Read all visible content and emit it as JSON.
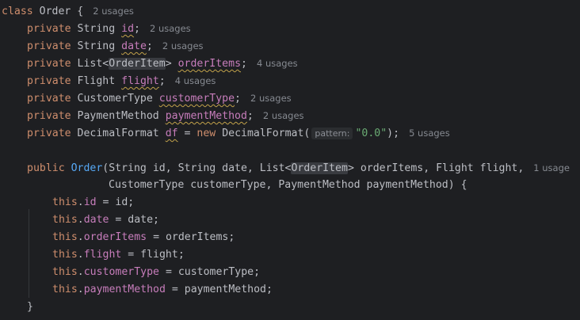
{
  "code": {
    "class_decl": {
      "keyword": "class",
      "name": "Order",
      "brace": " {",
      "usages": "2 usages"
    },
    "fields": [
      {
        "modifier": "private",
        "type": "String",
        "name": "id",
        "semi": ";",
        "usages": "2 usages"
      },
      {
        "modifier": "private",
        "type": "String",
        "name": "date",
        "semi": ";",
        "usages": "2 usages"
      },
      {
        "modifier": "private",
        "type_prefix": "List<",
        "type_param": "OrderItem",
        "type_suffix": ">",
        "name": "orderItems",
        "semi": ";",
        "usages": "4 usages"
      },
      {
        "modifier": "private",
        "type": "Flight",
        "name": "flight",
        "semi": ";",
        "usages": "4 usages"
      },
      {
        "modifier": "private",
        "type": "CustomerType",
        "name": "customerType",
        "semi": ";",
        "usages": "2 usages"
      },
      {
        "modifier": "private",
        "type": "PaymentMethod",
        "name": "paymentMethod",
        "semi": ";",
        "usages": "2 usages"
      },
      {
        "modifier": "private",
        "type": "DecimalFormat",
        "name": "df",
        "assign": " = ",
        "new_kw": "new",
        "ctor": " DecimalFormat(",
        "hint": "pattern:",
        "str": "\"0.0\"",
        "close": ");",
        "usages": "5 usages"
      }
    ],
    "ctor_decl": {
      "modifier": "public",
      "name": "Order",
      "params1_a": "(String id, String date, List<",
      "params1_hl": "OrderItem",
      "params1_b": "> orderItems, Flight flight,",
      "usages": "1 usage",
      "params2": "CustomerType customerType, PaymentMethod paymentMethod) {"
    },
    "assignments": [
      {
        "this": "this",
        "field": "id",
        "rhs": " = id;"
      },
      {
        "this": "this",
        "field": "date",
        "rhs": " = date;"
      },
      {
        "this": "this",
        "field": "orderItems",
        "rhs": " = orderItems;"
      },
      {
        "this": "this",
        "field": "flight",
        "rhs": " = flight;"
      },
      {
        "this": "this",
        "field": "customerType",
        "rhs": " = customerType;"
      },
      {
        "this": "this",
        "field": "paymentMethod",
        "rhs": " = paymentMethod;"
      }
    ],
    "closing_brace": "}"
  }
}
